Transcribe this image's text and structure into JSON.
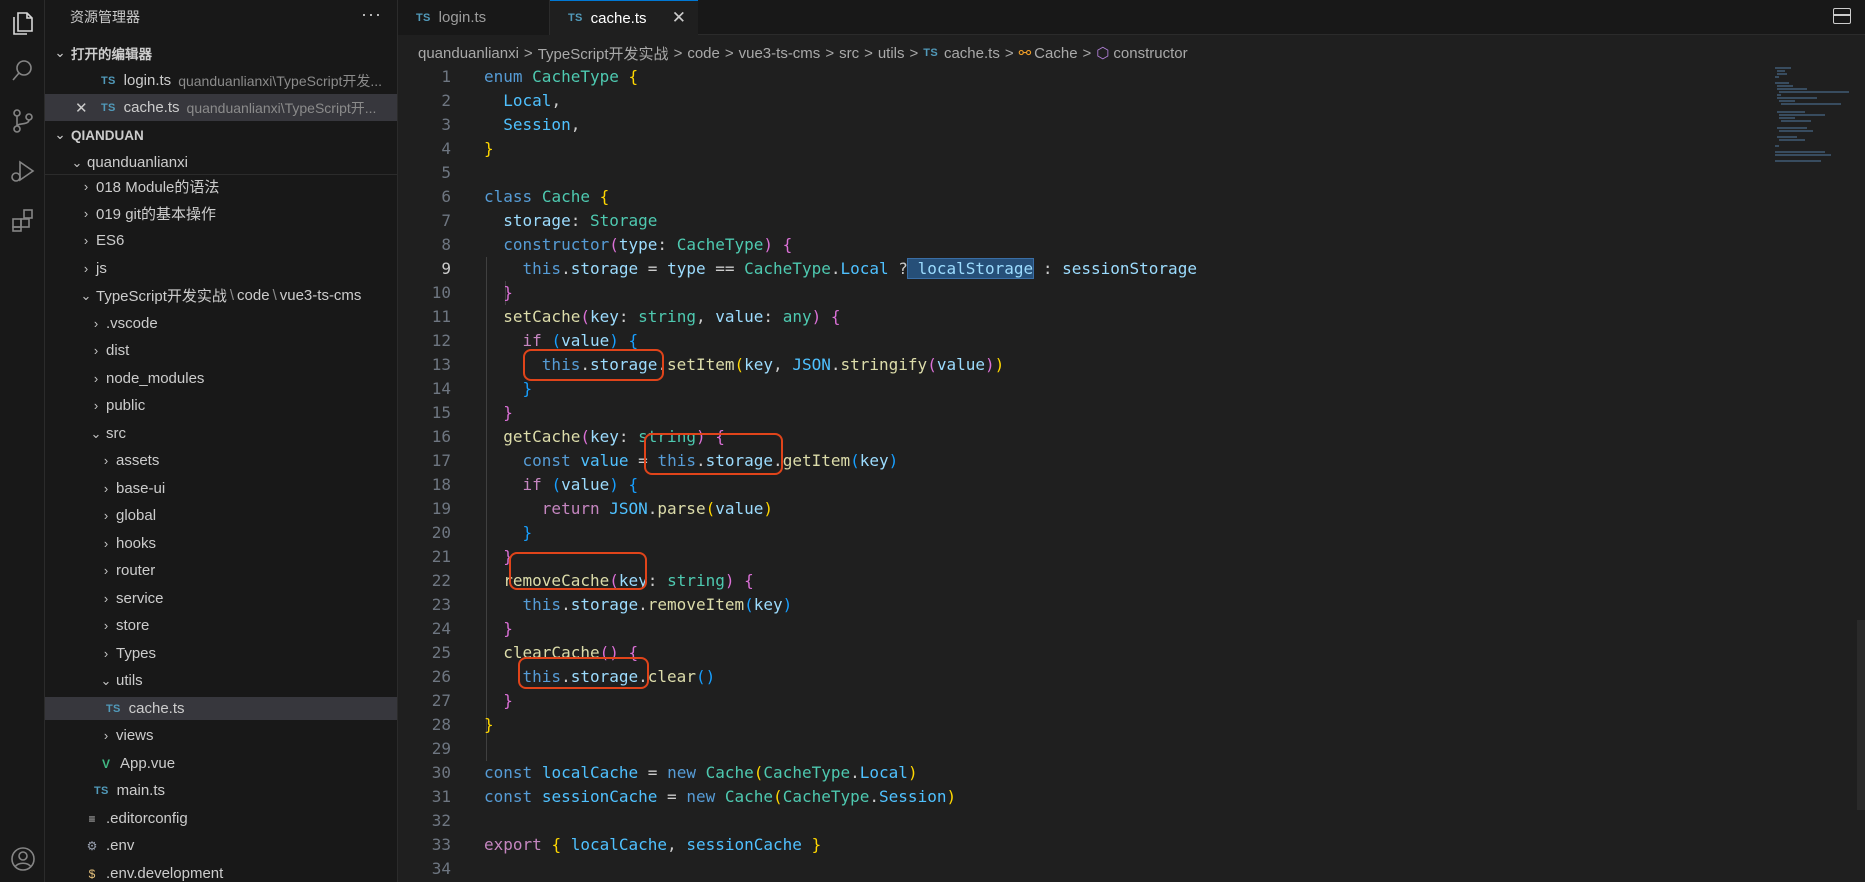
{
  "explorer": {
    "title": "资源管理器",
    "more": "···",
    "open_editors_title": "打开的编辑器",
    "open_editors": [
      {
        "badge": "TS",
        "name": "login.ts",
        "path": "quanduanlianxi\\TypeScript开发..."
      },
      {
        "badge": "TS",
        "name": "cache.ts",
        "path": "quanduanlianxi\\TypeScript开..."
      }
    ],
    "workspace_title": "QIANDUAN",
    "root_folder": "quanduanlianxi",
    "tree": {
      "f018": "018 Module的语法",
      "f019": "019 git的基本操作",
      "es6": "ES6",
      "js": "js",
      "ts_seg1": "TypeScript开发实战",
      "ts_seg2": "code",
      "ts_seg3": "vue3-ts-cms",
      "vscode": ".vscode",
      "dist": "dist",
      "node_modules": "node_modules",
      "public": "public",
      "src": "src",
      "assets": "assets",
      "base_ui": "base-ui",
      "global": "global",
      "hooks": "hooks",
      "router": "router",
      "service": "service",
      "store": "store",
      "types": "Types",
      "utils": "utils",
      "cache_ts": "cache.ts",
      "views": "views",
      "app_vue": "App.vue",
      "main_ts": "main.ts",
      "editorconfig": ".editorconfig",
      "env": ".env",
      "env_dev": ".env.development"
    }
  },
  "tabs": [
    {
      "badge": "TS",
      "label": "login.ts"
    },
    {
      "badge": "TS",
      "label": "cache.ts",
      "close": "✕"
    }
  ],
  "breadcrumb": {
    "items": [
      "quanduanlianxi",
      "TypeScript开发实战",
      "code",
      "vue3-ts-cms",
      "src",
      "utils"
    ],
    "file_badge": "TS",
    "file": "cache.ts",
    "class_name": "Cache",
    "member": "constructor",
    "separator": ">"
  },
  "editor": {
    "line_numbers": [
      "1",
      "2",
      "3",
      "4",
      "5",
      "6",
      "7",
      "8",
      "9",
      "10",
      "11",
      "12",
      "13",
      "14",
      "15",
      "16",
      "17",
      "18",
      "19",
      "20",
      "21",
      "22",
      "23",
      "24",
      "25",
      "26",
      "27",
      "28",
      "29",
      "30",
      "31",
      "32",
      "33",
      "34"
    ],
    "current_line": 9
  },
  "colors": {
    "accent": "#0078d4",
    "highlight_box": "#e0441a",
    "selection": "#264f78"
  },
  "icons": [
    "files-icon",
    "search-icon",
    "source-control-icon",
    "run-debug-icon",
    "extensions-icon",
    "account-icon"
  ]
}
